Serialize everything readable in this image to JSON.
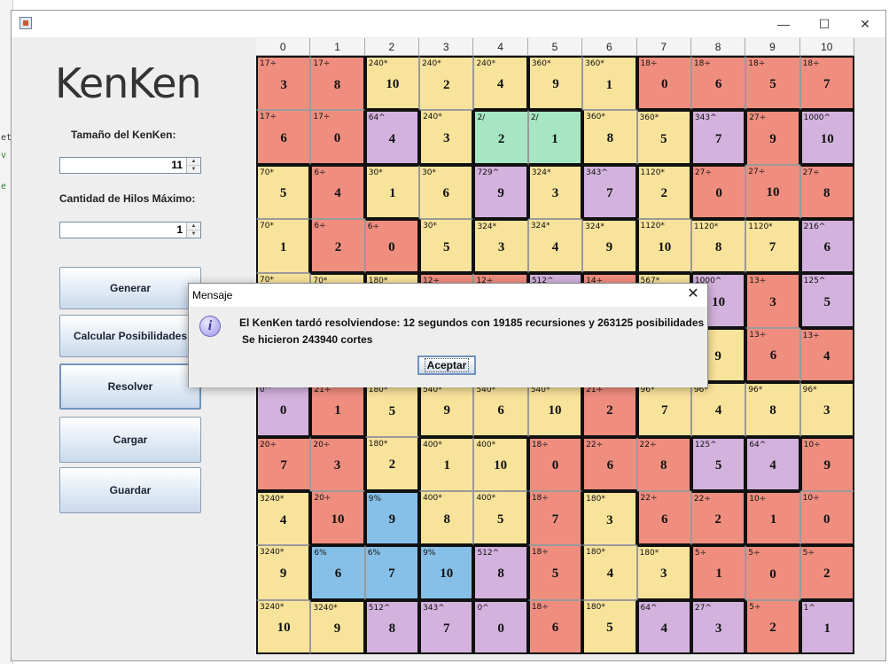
{
  "window": {
    "title": "",
    "minimize": "—",
    "maximize": "☐",
    "close": "✕"
  },
  "side": {
    "logo": "KenKen",
    "size_label": "Tamaño del KenKen:",
    "size_value": "11",
    "threads_label": "Cantidad de Hilos Máximo:",
    "threads_value": "1",
    "buttons": [
      "Generar",
      "Calcular Posibilidades",
      "Resolver",
      "Cargar",
      "Guardar"
    ]
  },
  "columns": [
    "0",
    "1",
    "2",
    "3",
    "4",
    "5",
    "6",
    "7",
    "8",
    "9",
    "10"
  ],
  "colors": {
    "r": "#ef8e7f",
    "y": "#f8e39b",
    "p": "#d3b2dd",
    "g": "#a6e6c2",
    "b": "#86c0e8"
  },
  "board": [
    [
      "r|17÷|3",
      "r|17÷|8",
      "y|240*|10",
      "y|240*|2",
      "y|240*|4",
      "y|360*|9",
      "y|360*|1",
      "r|18÷|0",
      "r|18÷|6",
      "r|18÷|5",
      "r|18÷|7"
    ],
    [
      "r|17÷|6",
      "r|17÷|0",
      "p|64^|4",
      "y|240*|3",
      "g|2/|2",
      "g|2/|1",
      "y|360*|8",
      "y|360*|5",
      "p|343^|7",
      "r|27÷|9",
      "p|1000^|10"
    ],
    [
      "y|70*|5",
      "r|6÷|4",
      "y|30*|1",
      "y|30*|6",
      "p|729^|9",
      "y|324*|3",
      "p|343^|7",
      "y|1120*|2",
      "r|27÷|0",
      "r|27÷|10",
      "r|27÷|8"
    ],
    [
      "y|70*|1",
      "r|6÷|2",
      "r|6÷|0",
      "y|30*|5",
      "y|324*|3",
      "y|324*|4",
      "y|324*|9",
      "y|1120*|10",
      "y|1120*|8",
      "y|1120*|7",
      "p|216^|6"
    ],
    [
      "y|70*|",
      "y|70*|",
      "y|180*|",
      "r|12÷|",
      "r|12÷|",
      "p|512^|",
      "r|14÷|",
      "y|567*|",
      "p|1000^|10",
      "r|13÷|3",
      "p|125^|5"
    ],
    [
      "y||",
      "y||",
      "y||",
      "y||",
      "y||",
      "y||",
      "y||",
      "y||",
      "y||9",
      "r|13÷|6",
      "r|13÷|4"
    ],
    [
      "p|0^|0",
      "r|21÷|1",
      "y|180*|5",
      "y|540*|9",
      "y|540*|6",
      "y|540*|10",
      "r|21÷|2",
      "y|96*|7",
      "y|96*|4",
      "y|96*|8",
      "y|96*|3"
    ],
    [
      "r|20÷|7",
      "r|20÷|3",
      "y|180*|2",
      "y|400*|1",
      "y|400*|10",
      "r|18÷|0",
      "r|22÷|6",
      "r|22÷|8",
      "p|125^|5",
      "p|64^|4",
      "r|10÷|9"
    ],
    [
      "y|3240*|4",
      "r|20÷|10",
      "b|9%|9",
      "y|400*|8",
      "y|400*|5",
      "r|18÷|7",
      "y|180*|3",
      "r|22÷|6",
      "r|22÷|2",
      "r|10÷|1",
      "r|10÷|0"
    ],
    [
      "y|3240*|9",
      "b|6%|6",
      "b|6%|7",
      "b|9%|10",
      "p|512^|8",
      "r|18÷|5",
      "y|180*|4",
      "y|180*|3",
      "r|5÷|1",
      "r|5÷|0",
      "r|5÷|2"
    ],
    [
      "y|3240*|10",
      "y|3240*|9",
      "p|512^|8",
      "p|343^|7",
      "p|0^|0",
      "r|18÷|6",
      "y|180*|5",
      "p|64^|4",
      "p|27^|3",
      "r|5÷|2",
      "p|1^|1"
    ]
  ],
  "dialog": {
    "title": "Mensaje",
    "close": "✕",
    "icon": "i",
    "line1": "El KenKen tardó resolviendose: 12 segundos con 19185 recursiones y 263125 posibilidades",
    "line2": "Se hicieron 243940 cortes",
    "ok": "Aceptar"
  }
}
